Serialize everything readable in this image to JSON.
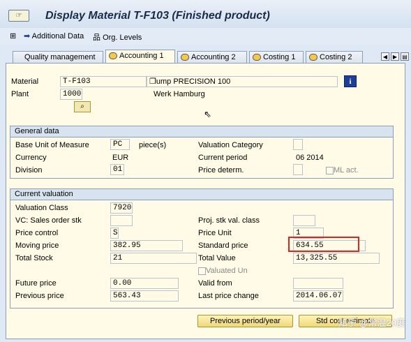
{
  "window": {
    "title": "Display Material T-F103 (Finished product)"
  },
  "toolbar": {
    "additional_data": "Additional Data",
    "org_levels": "Org. Levels"
  },
  "tabs": [
    {
      "label": "Quality management",
      "active": false
    },
    {
      "label": "Accounting 1",
      "active": true
    },
    {
      "label": "Accounting 2",
      "active": false
    },
    {
      "label": "Costing 1",
      "active": false
    },
    {
      "label": "Costing 2",
      "active": false
    }
  ],
  "header": {
    "material_label": "Material",
    "material_value": "T-F103",
    "material_desc": "ump PRECISION 100",
    "plant_label": "Plant",
    "plant_value": "1000",
    "plant_desc": "Werk Hamburg"
  },
  "general": {
    "title": "General data",
    "base_uom_label": "Base Unit of Measure",
    "base_uom_value": "PC",
    "base_uom_text": "piece(s)",
    "valuation_category_label": "Valuation Category",
    "currency_label": "Currency",
    "currency_value": "EUR",
    "current_period_label": "Current period",
    "current_period_value": "06 2014",
    "division_label": "Division",
    "division_value": "01",
    "price_determ_label": "Price determ.",
    "ml_act_label": "ML act."
  },
  "valuation": {
    "title": "Current valuation",
    "valuation_class_label": "Valuation Class",
    "valuation_class_value": "7920",
    "vc_sales_label": "VC: Sales order stk",
    "proj_stk_label": "Proj. stk val. class",
    "price_control_label": "Price control",
    "price_control_value": "S",
    "price_unit_label": "Price Unit",
    "price_unit_value": "1",
    "moving_price_label": "Moving price",
    "moving_price_value": "382.95",
    "standard_price_label": "Standard price",
    "standard_price_value": "634.55",
    "total_stock_label": "Total Stock",
    "total_stock_value": "21",
    "total_value_label": "Total Value",
    "total_value_value": "13,325.55",
    "valuated_un_label": "Valuated Un",
    "future_price_label": "Future price",
    "future_price_value": "0.00",
    "valid_from_label": "Valid from",
    "previous_price_label": "Previous price",
    "previous_price_value": "563.43",
    "last_price_change_label": "Last price change",
    "last_price_change_value": "2014.06.07"
  },
  "buttons": {
    "previous_period": "Previous period/year",
    "cost_estimate": "Std cost estimate"
  },
  "watermark": "知乎 @常温20度"
}
